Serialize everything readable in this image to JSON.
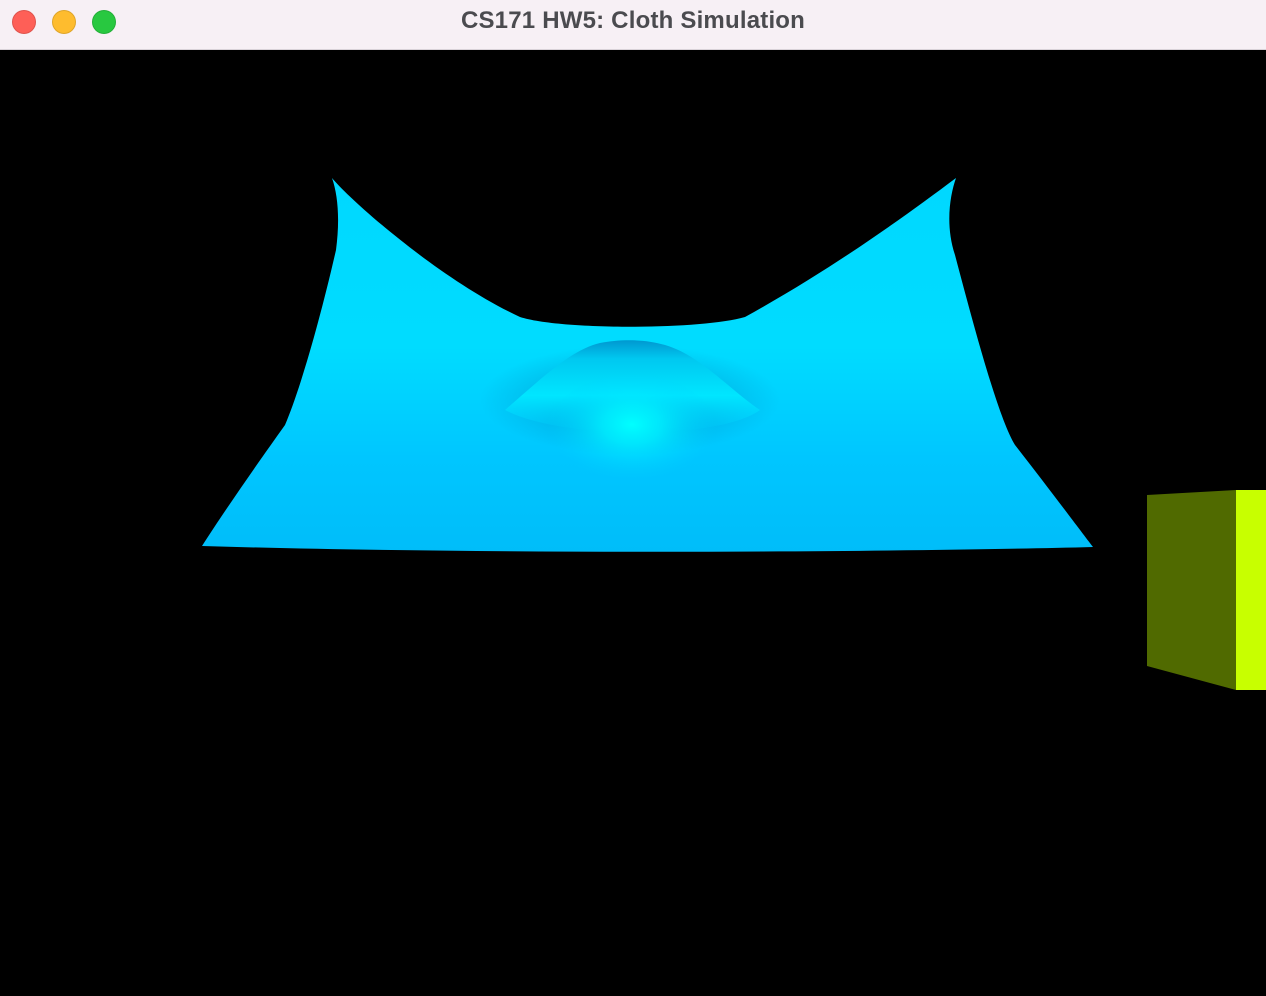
{
  "window": {
    "title": "CS171 HW5: Cloth Simulation",
    "controls": [
      {
        "name": "close",
        "color": "#fe5f57"
      },
      {
        "name": "minimize",
        "color": "#febc2e"
      },
      {
        "name": "zoom",
        "color": "#28c840"
      }
    ]
  },
  "scene": {
    "background": "#000000",
    "cloth": {
      "color_base": "#00bfff",
      "color_highlight": "#00ffff",
      "color_shadow": "#0077b8"
    },
    "box": {
      "front_color": "#506a00",
      "side_color": "#c8ff00"
    }
  }
}
